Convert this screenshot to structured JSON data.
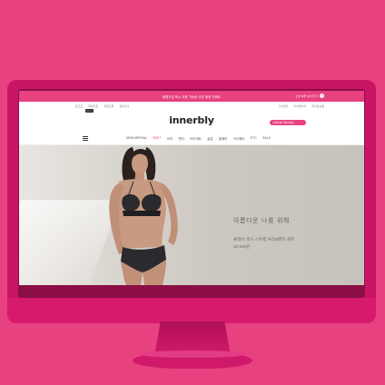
{
  "promo": {
    "text": "회원가입 즉시 사용 가능한 쿠폰 증정 이벤트",
    "right_text": "오늘 하루 보지 않기",
    "close_icon": "close-icon"
  },
  "utility": {
    "links": [
      "로그인",
      "회원가입",
      "주문조회",
      "장바구니"
    ],
    "badge": "NEW",
    "right_links": [
      "고객센터",
      "마이페이지",
      "최근본상품"
    ]
  },
  "header": {
    "logo": "innerbly",
    "search_placeholder": "검색어를 입력하세요"
  },
  "nav": {
    "menu_icon": "menu-icon",
    "items": [
      "NEW ARRIVAL",
      "BEST",
      "브라",
      "팬티",
      "브라세트",
      "슬립",
      "홈웨어",
      "이너웨어",
      "ETC",
      "SALE"
    ],
    "active_index": 1
  },
  "hero": {
    "title": "아름다운 나를 위해",
    "product": "플레어 섹시 스트랩 브라&팬티 세트",
    "price": "25,900원"
  },
  "colors": {
    "brand": "#e8417f",
    "monitor": "#c81566"
  }
}
